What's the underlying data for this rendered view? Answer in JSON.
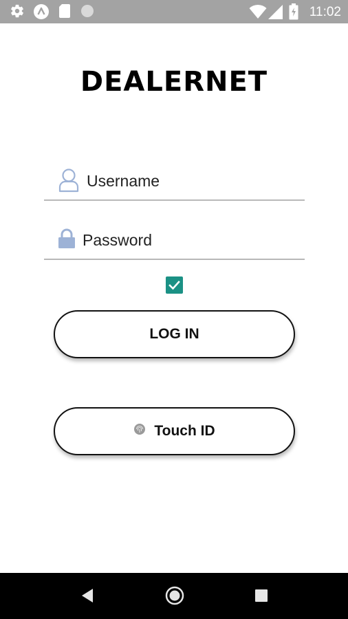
{
  "status_bar": {
    "time": "11:02",
    "left_icons": [
      "settings-icon",
      "app-a-icon",
      "sd-card-icon",
      "circle-icon"
    ],
    "right_icons": [
      "wifi-icon",
      "cell-signal-icon",
      "battery-icon"
    ],
    "background": "#a3a3a3"
  },
  "app": {
    "title": "DEALERNET"
  },
  "login_form": {
    "username": {
      "placeholder": "Username",
      "value": "",
      "icon": "user-icon"
    },
    "password": {
      "placeholder": "Password",
      "value": "",
      "icon": "lock-icon"
    },
    "remember_checkbox": {
      "checked": true,
      "color": "#1b9185"
    },
    "login_label": "LOG IN",
    "touch_id_label": "Touch ID",
    "touch_id_icon": "fingerprint-icon"
  },
  "nav_bar": {
    "buttons": [
      "back-icon",
      "home-icon",
      "recents-icon"
    ]
  },
  "colors": {
    "icon_accent": "#9db2d6",
    "checkbox": "#1b9185",
    "underline": "#b8b8b8"
  }
}
